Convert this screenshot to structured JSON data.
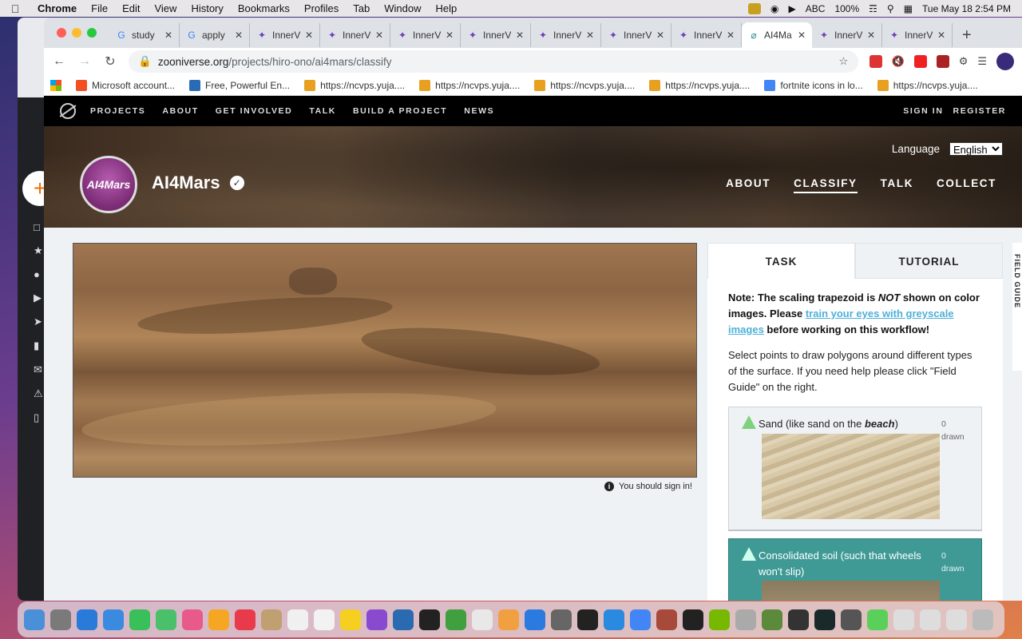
{
  "menubar": {
    "app": "Chrome",
    "items": [
      "File",
      "Edit",
      "View",
      "History",
      "Bookmarks",
      "Profiles",
      "Tab",
      "Window",
      "Help"
    ],
    "input_source": "ABC",
    "battery": "100%",
    "clock": "Tue May 18  2:54 PM"
  },
  "browser": {
    "tabs": [
      {
        "title": "study",
        "icon": "google-icon"
      },
      {
        "title": "apply",
        "icon": "google-icon"
      },
      {
        "title": "InnerV",
        "icon": "innerv-icon"
      },
      {
        "title": "InnerV",
        "icon": "innerv-icon"
      },
      {
        "title": "InnerV",
        "icon": "innerv-icon"
      },
      {
        "title": "InnerV",
        "icon": "innerv-icon"
      },
      {
        "title": "InnerV",
        "icon": "innerv-icon"
      },
      {
        "title": "InnerV",
        "icon": "innerv-icon"
      },
      {
        "title": "InnerV",
        "icon": "innerv-icon"
      },
      {
        "title": "AI4Ma",
        "icon": "zooniverse-icon",
        "active": true
      },
      {
        "title": "InnerV",
        "icon": "innerv-icon"
      },
      {
        "title": "InnerV",
        "icon": "innerv-icon"
      }
    ],
    "url_host": "zooniverse.org",
    "url_path": "/projects/hiro-ono/ai4mars/classify",
    "bookmarks": [
      {
        "label": "Microsoft account...",
        "icon": "microsoft-icon"
      },
      {
        "label": "Free, Powerful En...",
        "icon": "wordpress-icon"
      },
      {
        "label": "https://ncvps.yuja....",
        "icon": "yuja-icon"
      },
      {
        "label": "https://ncvps.yuja....",
        "icon": "yuja-icon"
      },
      {
        "label": "https://ncvps.yuja....",
        "icon": "yuja-icon"
      },
      {
        "label": "https://ncvps.yuja....",
        "icon": "yuja-icon"
      },
      {
        "label": "fortnite icons in lo...",
        "icon": "google-icon"
      },
      {
        "label": "https://ncvps.yuja....",
        "icon": "yuja-icon"
      }
    ]
  },
  "zooniverse_nav": {
    "links": [
      "PROJECTS",
      "ABOUT",
      "GET INVOLVED",
      "TALK",
      "BUILD A PROJECT",
      "NEWS"
    ],
    "sign_in": "SIGN IN",
    "register": "REGISTER"
  },
  "project": {
    "avatar_text": "AI4Mars",
    "name": "AI4Mars",
    "language_label": "Language",
    "language_value": "English",
    "tabs": [
      "ABOUT",
      "CLASSIFY",
      "TALK",
      "COLLECT"
    ],
    "active_tab": "CLASSIFY"
  },
  "classifier": {
    "sign_in_notice": "You should sign in!",
    "task_tab": "TASK",
    "tutorial_tab": "TUTORIAL",
    "note_prefix": "Note: The scaling trapezoid is ",
    "note_emphasis": "NOT",
    "note_mid": " shown on color images. Please ",
    "note_link": "train your eyes with greyscale images",
    "note_suffix": " before working on this workflow!",
    "instructions": "Select points to draw polygons around different types of the surface. If you need help please click \"Field Guide\" on the right.",
    "answers": [
      {
        "label_prefix": "Sand (like sand on the ",
        "label_em": "beach",
        "label_suffix": ")",
        "count": "0",
        "count_label": "drawn",
        "selected": false
      },
      {
        "label_prefix": "Consolidated soil (such that wheels won't slip)",
        "label_em": "",
        "label_suffix": "",
        "count": "0",
        "count_label": "drawn",
        "selected": true
      }
    ],
    "field_guide": "FIELD GUIDE"
  },
  "colors": {
    "selected_answer": "#3f9a96",
    "link": "#4fb0d8",
    "nav_bg": "#000000"
  }
}
